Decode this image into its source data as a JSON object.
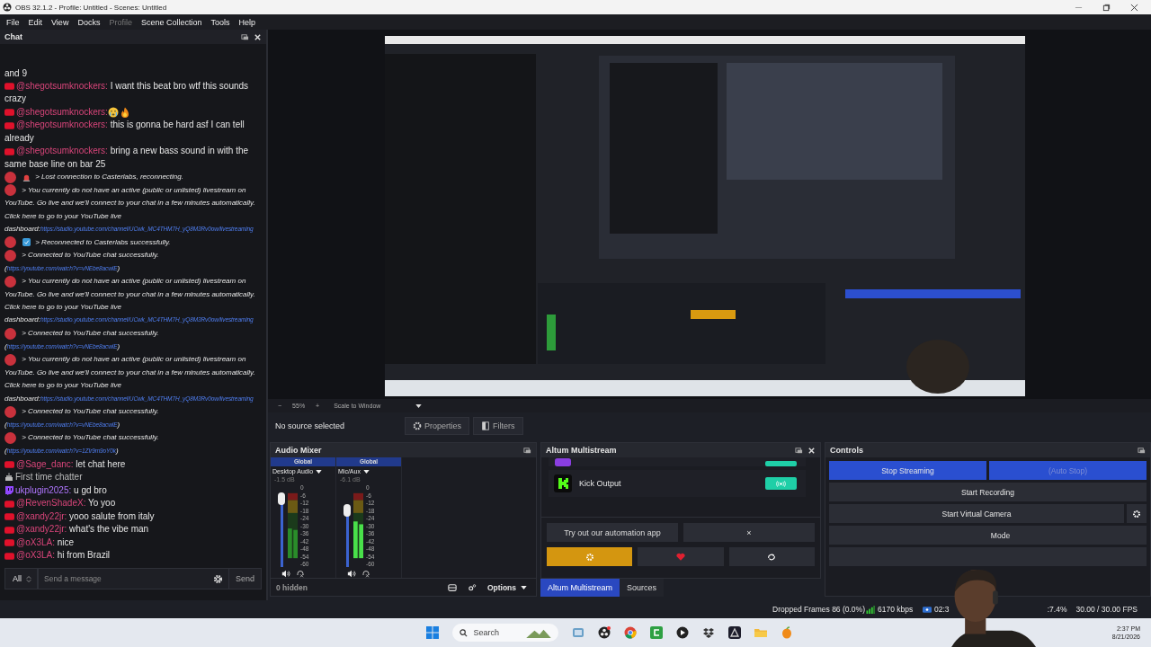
{
  "window": {
    "title": "OBS 32.1.2 - Profile: Untitled - Scenes: Untitled"
  },
  "menu": [
    {
      "label": "File",
      "disabled": false
    },
    {
      "label": "Edit",
      "disabled": false
    },
    {
      "label": "View",
      "disabled": false
    },
    {
      "label": "Docks",
      "disabled": false
    },
    {
      "label": "Profile",
      "disabled": true
    },
    {
      "label": "Scene Collection",
      "disabled": false
    },
    {
      "label": "Tools",
      "disabled": false
    },
    {
      "label": "Help",
      "disabled": false
    }
  ],
  "chat": {
    "title": "Chat",
    "messages": [
      {
        "kind": "text",
        "text": "and 9"
      },
      {
        "kind": "youtube_user",
        "name": "@shegotsumknockers:",
        "text": "I want this beat bro wtf this sounds crazy"
      },
      {
        "kind": "youtube_emote",
        "name": "@shegotsumknockers:"
      },
      {
        "kind": "youtube_user",
        "name": "@shegotsumknockers:",
        "text": "this is gonna be hard asf I can tell already"
      },
      {
        "kind": "youtube_user",
        "name": "@shegotsumknockers:",
        "text": "bring a new bass sound in with the same base line on bar 25"
      },
      {
        "kind": "system_error",
        "text": "> Lost connection to Casterlabs, reconnecting."
      },
      {
        "kind": "system",
        "text": "> You currently do not have an active (public or unlisted) livestream on YouTube. Go live and we'll connect to your chat in a few minutes automatically. Click here to go to your YouTube live dashboard:",
        "link": "https://studio.youtube.com/channel/UCwk_MC4THM7H_yQ8M3Rv0ow/livestreaming"
      },
      {
        "kind": "system_ok",
        "text": "> Reconnected to Casterlabs successfully."
      },
      {
        "kind": "system",
        "text": "> Connected to YouTube chat successfully. (",
        "link": "https://youtube.com/watch?v=vNEbe8acwlE",
        "after": ")"
      },
      {
        "kind": "system",
        "text": "> You currently do not have an active (public or unlisted) livestream on YouTube. Go live and we'll connect to your chat in a few minutes automatically. Click here to go to your YouTube live dashboard:",
        "link": "https://studio.youtube.com/channel/UCwk_MC4THM7H_yQ8M3Rv0ow/livestreaming"
      },
      {
        "kind": "system",
        "text": "> Connected to YouTube chat successfully. (",
        "link": "https://youtube.com/watch?v=vNEbe8acwlE",
        "after": ")"
      },
      {
        "kind": "system",
        "text": "> You currently do not have an active (public or unlisted) livestream on YouTube. Go live and we'll connect to your chat in a few minutes automatically. Click here to go to your YouTube live dashboard:",
        "link": "https://studio.youtube.com/channel/UCwk_MC4THM7H_yQ8M3Rv0ow/livestreaming"
      },
      {
        "kind": "system",
        "text": "> Connected to YouTube chat successfully. (",
        "link": "https://youtube.com/watch?v=vNEbe8acwlE",
        "after": ")"
      },
      {
        "kind": "system",
        "text": "> Connected to YouTube chat successfully. (",
        "link": "https://youtube.com/watch?v=1ZIr9m9oY0k",
        "after": ")"
      },
      {
        "kind": "youtube_user",
        "name": "@Sage_danc:",
        "text": "let chat here"
      },
      {
        "kind": "badge",
        "text": "First time chatter"
      },
      {
        "kind": "twitch_user",
        "name": "ukplugin2025:",
        "text": "u gd bro"
      },
      {
        "kind": "youtube_user",
        "name": "@RevenShadeX:",
        "text": "Yo yoo"
      },
      {
        "kind": "youtube_user",
        "name": "@xandy22jr:",
        "text": "yooo salute from italy"
      },
      {
        "kind": "youtube_user",
        "name": "@xandy22jr:",
        "text": "what's the vibe man"
      },
      {
        "kind": "youtube_user",
        "name": "@oX3LA:",
        "text": "nice"
      },
      {
        "kind": "youtube_user",
        "name": "@oX3LA:",
        "text": "hi from Brazil"
      }
    ],
    "filter": "All",
    "placeholder": "Send a message",
    "send": "Send"
  },
  "preview": {
    "kind": "picture",
    "zoom_out": "−",
    "zoom": "55%",
    "zoom_in": "+",
    "scale_mode": "Scale to Window"
  },
  "context_bar": {
    "status": "No source selected",
    "properties": "Properties",
    "filters": "Filters"
  },
  "audio_mixer": {
    "title": "Audio Mixer",
    "channels": [
      {
        "group": "Global",
        "name": "Desktop Audio",
        "reading": "-1.5 dB",
        "level": 0.88,
        "scale": [
          "0",
          "-6",
          "-12",
          "-18",
          "-24",
          "-30",
          "-36",
          "-42",
          "-48",
          "-54",
          "-60"
        ]
      },
      {
        "group": "Global",
        "name": "Mic/Aux",
        "reading": "-6.1 dB",
        "level": 0.72,
        "scale": [
          "0",
          "-6",
          "-12",
          "-18",
          "-24",
          "-30",
          "-36",
          "-42",
          "-48",
          "-54",
          "-60"
        ]
      }
    ],
    "hidden": "0 hidden",
    "options": "Options"
  },
  "altum": {
    "title": "Altum Multistream",
    "outputs": [
      {
        "kind": "twitch"
      },
      {
        "kind": "kick",
        "name": "Kick Output"
      }
    ],
    "promo": "Try out our automation app",
    "dismiss": "×"
  },
  "dock_tabs": [
    {
      "label": "Altum Multistream",
      "selected": true
    },
    {
      "label": "Sources",
      "selected": false
    }
  ],
  "controls": {
    "title": "Controls",
    "buttons": [
      {
        "label": "Stop Streaming",
        "active": true,
        "disabled": false,
        "settings": false,
        "half": true
      },
      {
        "label": "(Auto Stop)",
        "active": true,
        "disabled": true,
        "settings": false,
        "half": true
      },
      {
        "label": "Start Recording",
        "active": false,
        "disabled": false,
        "settings": false,
        "half": false
      },
      {
        "label": "Start Virtual Camera",
        "active": false,
        "disabled": false,
        "settings": true,
        "half": false
      },
      {
        "label": "Mode",
        "active": false,
        "disabled": false,
        "settings": false,
        "half": false
      },
      {
        "active": false,
        "disabled": false,
        "settings": false,
        "half": false
      }
    ]
  },
  "status_bar": {
    "dropped_frames": "Dropped Frames 86 (0.0%)",
    "bitrate": "6170 kbps",
    "time": "02:3",
    "cpu": ":7.4%",
    "fps": "30.00 / 30.00 FPS"
  },
  "taskbar": {
    "search": "Search",
    "time": "2:37 PM",
    "date": "8/21/2026"
  }
}
